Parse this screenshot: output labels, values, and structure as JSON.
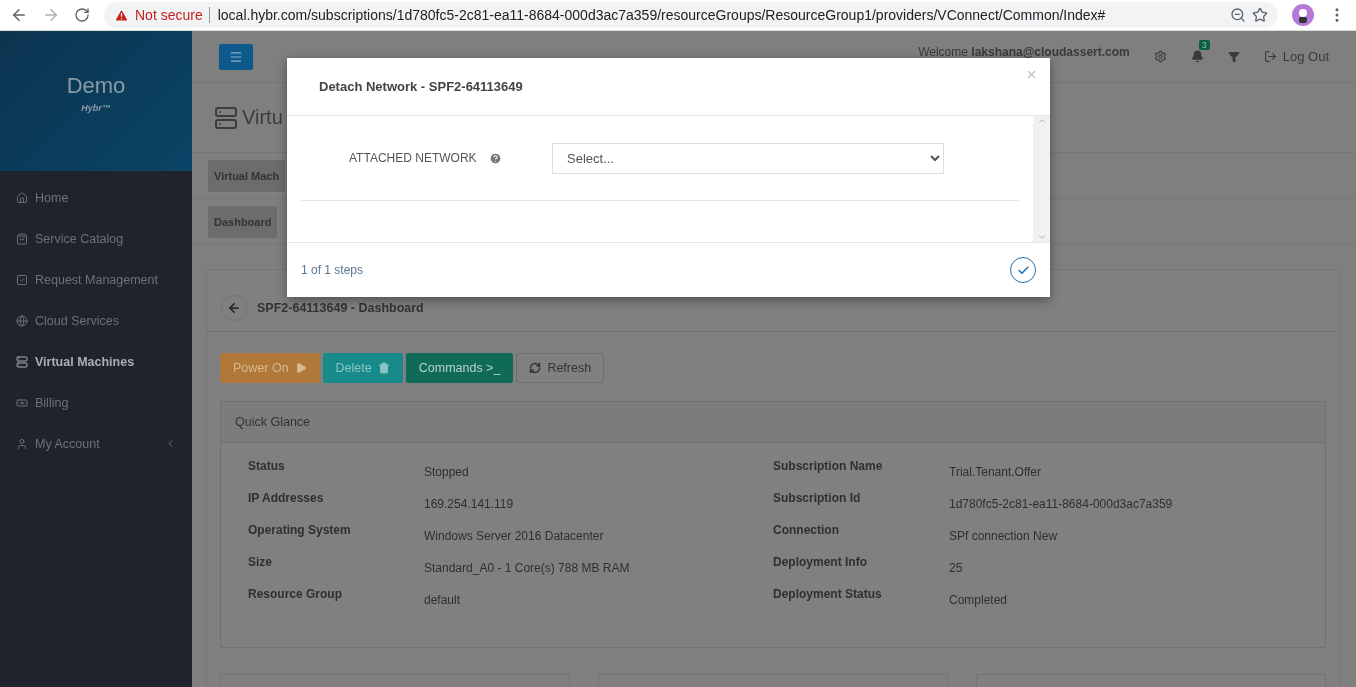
{
  "browser": {
    "warning": "Not secure",
    "url": "local.hybr.com/subscriptions/1d780fc5-2c81-ea11-8684-000d3ac7a359/resourceGroups/ResourceGroup1/providers/VConnect/Common/Index#"
  },
  "sidebar": {
    "brand": "Demo",
    "tagline": "Hybr™",
    "items": [
      {
        "label": "Home",
        "selected": false,
        "kind": "link"
      },
      {
        "label": "Service Catalog",
        "selected": false,
        "kind": "link"
      },
      {
        "label": "Request Management",
        "selected": false,
        "kind": "link"
      },
      {
        "label": "Cloud Services",
        "selected": false,
        "kind": "link"
      },
      {
        "label": "Virtual Machines",
        "selected": true,
        "kind": "link"
      },
      {
        "label": "Billing",
        "selected": false,
        "kind": "link"
      },
      {
        "label": "My Account",
        "selected": false,
        "kind": "menu"
      }
    ]
  },
  "header": {
    "welcome": "Welcome",
    "user": "lakshana@cloudassert.com",
    "notifications": "3",
    "logout": "Log Out"
  },
  "page": {
    "title": "Virtu",
    "tabs": [
      "Virtual Mach",
      "Dashboard"
    ]
  },
  "card": {
    "title": "SPF2-64113649 - Dashboard",
    "buttons": [
      {
        "label": "Power On",
        "kind": "power"
      },
      {
        "label": "Delete",
        "kind": "delete"
      },
      {
        "label": "Commands >_",
        "kind": "commands"
      },
      {
        "label": "Refresh",
        "kind": "refresh"
      }
    ],
    "quick_glance": {
      "title": "Quick Glance",
      "left": [
        {
          "label": "Status",
          "value": "Stopped"
        },
        {
          "label": "IP Addresses",
          "value": "169.254.141.119"
        },
        {
          "label": "Operating System",
          "value": "Windows Server 2016 Datacenter"
        },
        {
          "label": "Size",
          "value": "Standard_A0 - 1 Core(s) 788 MB RAM"
        },
        {
          "label": "Resource Group",
          "value": "default"
        }
      ],
      "right": [
        {
          "label": "Subscription Name",
          "value": "Trial.Tenant.Offer"
        },
        {
          "label": "Subscription Id",
          "value": "1d780fc5-2c81-ea11-8684-000d3ac7a359"
        },
        {
          "label": "Connection",
          "value": "SPf connection New"
        },
        {
          "label": "Deployment Info",
          "value": "25"
        },
        {
          "label": "Deployment Status",
          "value": "Completed"
        }
      ]
    }
  },
  "modal": {
    "title": "Detach Network - SPF2-64113649",
    "field_label": "ATTACHED NETWORK",
    "select_value": "Select...",
    "steps": "1 of 1 steps"
  }
}
